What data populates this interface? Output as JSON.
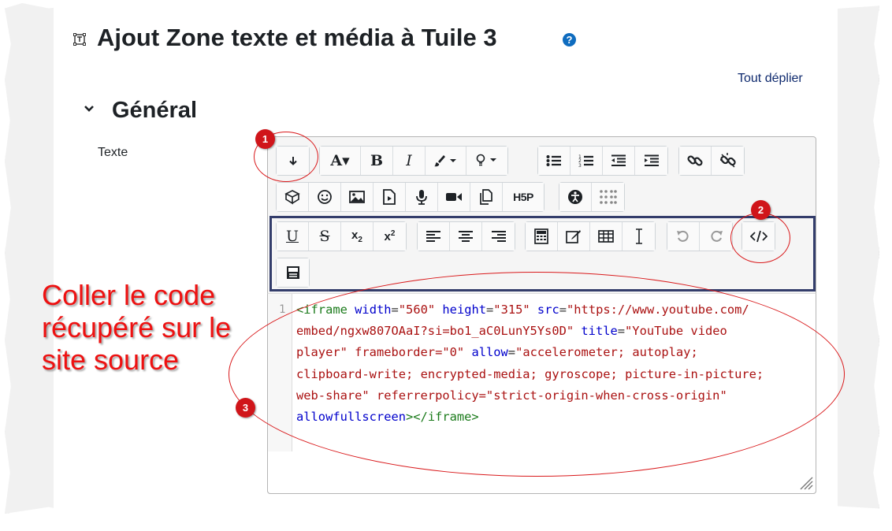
{
  "header": {
    "title": "Ajout Zone texte et média à Tuile 3",
    "help_icon": "question-circle-icon",
    "expand_all": "Tout déplier"
  },
  "section": {
    "title": "Général"
  },
  "field": {
    "label": "Texte"
  },
  "toolbar": {
    "row1": [
      "toggle-more-icon",
      "font-icon",
      "bold-icon",
      "italic-icon",
      "brush-icon",
      "lightbulb-icon",
      "bullet-list-icon",
      "numbered-list-icon",
      "outdent-icon",
      "indent-icon",
      "link-icon",
      "unlink-icon"
    ],
    "row2": [
      "block-icon",
      "emoji-icon",
      "image-icon",
      "media-file-icon",
      "microphone-icon",
      "video-icon",
      "manage-files-icon",
      "h5p-icon",
      "accessibility-icon",
      "braille-icon"
    ],
    "row3": [
      "underline-icon",
      "strikethrough-icon",
      "subscript-icon",
      "superscript-icon",
      "align-left-icon",
      "align-center-icon",
      "align-right-icon",
      "calculator-icon",
      "edit-icon",
      "table-icon",
      "cursor-icon",
      "undo-icon",
      "redo-icon",
      "html-icon"
    ],
    "row4": [
      "screenreader-icon"
    ],
    "h5p_label": "H5P"
  },
  "editor": {
    "line_number": "1",
    "code_lines": [
      "<iframe width=\"560\" height=\"315\" src=\"https://www.youtube.com/",
      "embed/ngxw807OAaI?si=bo1_aC0LunY5Ys0D\" title=\"YouTube video",
      "player\" frameborder=\"0\" allow=\"accelerometer; autoplay;",
      "clipboard-write; encrypted-media; gyroscope; picture-in-picture;",
      "web-share\" referrerpolicy=\"strict-origin-when-cross-origin\"",
      "allowfullscreen></iframe>"
    ]
  },
  "annotations": {
    "callout_lines": [
      "Coller le code",
      "récupéré sur le",
      "site source"
    ],
    "badges": [
      "1",
      "2",
      "3"
    ],
    "color": "#d0151a"
  },
  "colors": {
    "accent": "#0f6cbf",
    "frame": "#333d6b"
  }
}
